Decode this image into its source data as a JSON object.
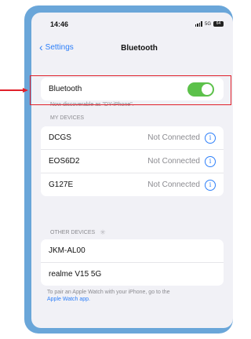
{
  "status": {
    "time": "14:46",
    "network": "5G",
    "battery": "64"
  },
  "nav": {
    "back_label": "Settings",
    "title": "Bluetooth"
  },
  "bluetooth": {
    "label": "Bluetooth",
    "enabled": true,
    "discoverable_text": "Now discoverable as \"DY-iPhone\"."
  },
  "my_devices": {
    "header": "MY DEVICES",
    "items": [
      {
        "name": "DCGS",
        "status": "Not Connected"
      },
      {
        "name": "EOS6D2",
        "status": "Not Connected"
      },
      {
        "name": "G127E",
        "status": "Not Connected"
      }
    ]
  },
  "other_devices": {
    "header": "OTHER DEVICES",
    "items": [
      {
        "name": "JKM-AL00"
      },
      {
        "name": "realme V15 5G"
      }
    ]
  },
  "footer": {
    "text": "To pair an Apple Watch with your iPhone, go to the",
    "link": "Apple Watch app."
  },
  "colors": {
    "accent": "#2d7ff9",
    "toggle_on": "#5cc14a",
    "highlight": "#e0202a"
  }
}
